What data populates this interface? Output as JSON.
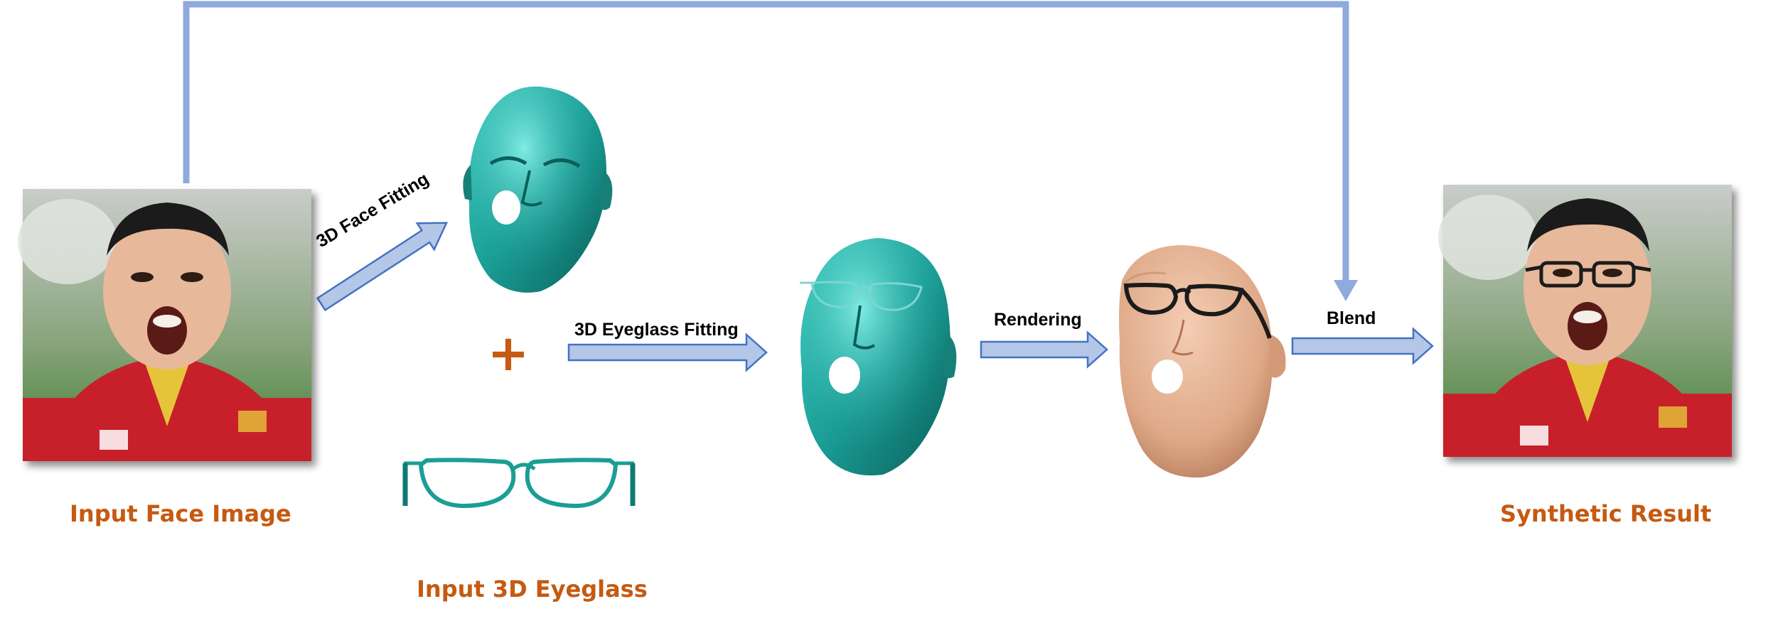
{
  "captions": {
    "input_face": "Input Face Image",
    "input_eyeglass": "Input 3D Eyeglass",
    "synthetic": "Synthetic Result"
  },
  "steps": {
    "face_fitting": "3D Face Fitting",
    "plus": "+",
    "eyeglass_fitting": "3D Eyeglass Fitting",
    "rendering": "Rendering",
    "blend": "Blend"
  },
  "colors": {
    "arrow_fill": "#b4c7e7",
    "arrow_stroke": "#4472c4",
    "connector": "#8faadc",
    "caption": "#c55a11",
    "mesh": "#1a9e96",
    "skin": "#e8b89a",
    "jacket": "#c8202a",
    "background_green": "#4f8a3c"
  },
  "icons": [
    "face-photo",
    "face-mesh",
    "eyeglass-mesh",
    "fitted-mesh",
    "rendered-face",
    "result-photo"
  ]
}
